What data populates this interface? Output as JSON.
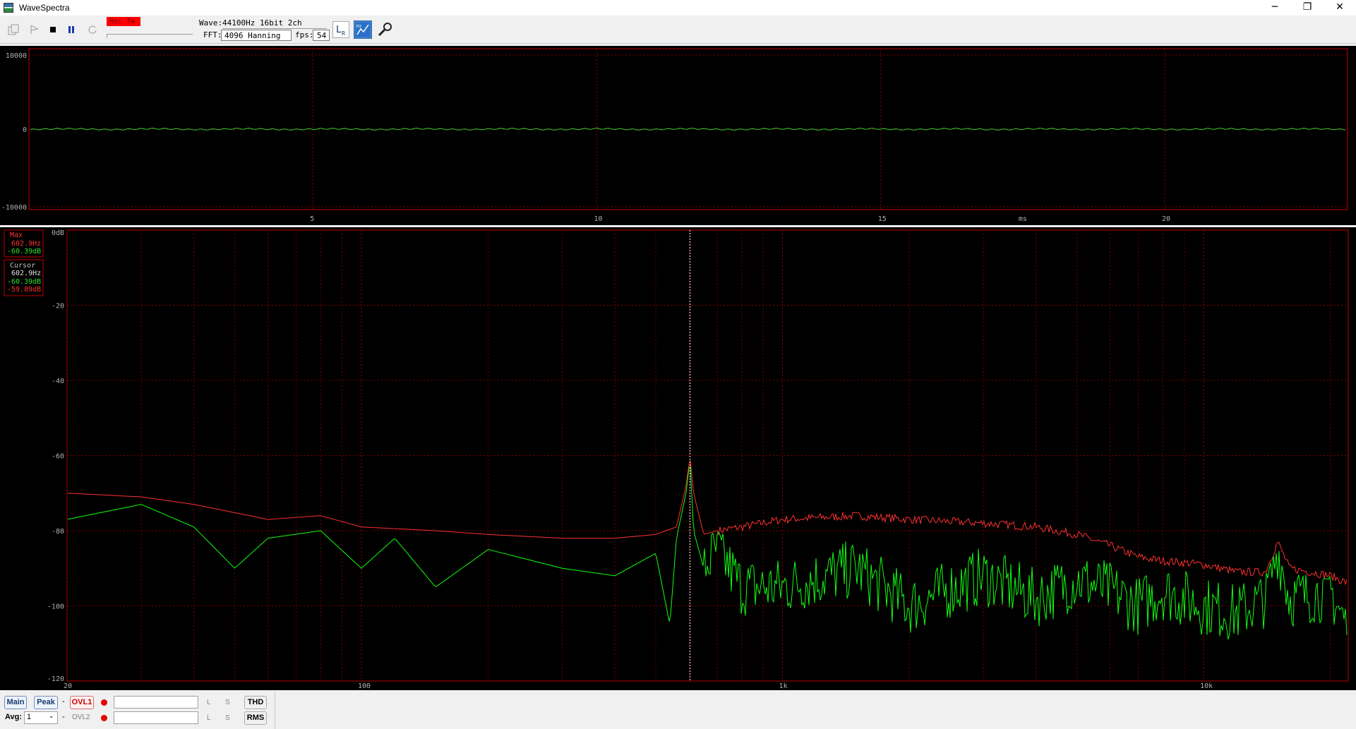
{
  "window": {
    "title": "WaveSpectra",
    "minimize": "─",
    "restore": "❐",
    "close": "✕"
  },
  "toolbar": {
    "rec_label": "Rec Tm",
    "wave_label": "Wave:",
    "wave_value": "44100Hz 16bit 2ch",
    "fft_label": "FFT:",
    "fft_value": "4096 Hanning",
    "fps_label": "fps:",
    "fps_value": "54",
    "icons": [
      "open-icon",
      "play-icon",
      "stop-icon",
      "pause-icon",
      "loop-icon",
      "lr-icon",
      "spectrum-settings-icon",
      "wrench-icon"
    ]
  },
  "waveform": {
    "y_ticks": [
      "10000",
      "0",
      "-10000"
    ],
    "x_ticks": [
      "5",
      "10",
      "15",
      "20"
    ],
    "x_unit": "ms"
  },
  "spectrum": {
    "y_ticks": [
      "0dB",
      "-20",
      "-40",
      "-60",
      "-80",
      "-100",
      "-120"
    ],
    "x_ticks": [
      "20",
      "100",
      "1k",
      "10k"
    ],
    "max_box": {
      "label": "Max",
      "freq": "602.9Hz",
      "db": "-60.39dB"
    },
    "cursor_box": {
      "label": "Cursor",
      "freq": "602.9Hz",
      "db1": "-60.39dB",
      "db2": "-59.89dB"
    },
    "colors": {
      "max_line": "#ff3030",
      "live_line": "#00ff00",
      "grid": "#c00000"
    }
  },
  "chart_data": {
    "type": "line",
    "xscale": "log",
    "xlim": [
      20,
      22050
    ],
    "ylim": [
      -120,
      0
    ],
    "xlabel": "",
    "ylabel": "",
    "series": [
      {
        "x": [
          20,
          30,
          40,
          60,
          80,
          100,
          150,
          200,
          300,
          400,
          500,
          560,
          590,
          602.9,
          615,
          650,
          700,
          800,
          1000,
          1500,
          2000,
          3000,
          4000,
          5000,
          6000,
          7000,
          8000,
          10000,
          12000,
          14000,
          15000,
          16000,
          18000,
          20000,
          22050
        ],
        "values": [
          -70,
          -71,
          -73,
          -77,
          -76,
          -79,
          -80,
          -81,
          -82,
          -82,
          -81,
          -79,
          -68,
          -60.39,
          -70,
          -81,
          -80,
          -79,
          -77,
          -76,
          -77,
          -78,
          -79,
          -81,
          -84,
          -87,
          -88,
          -89,
          -91,
          -91,
          -83,
          -90,
          -91,
          -92,
          -94
        ]
      },
      {
        "x": [
          20,
          30,
          40,
          50,
          60,
          80,
          100,
          120,
          150,
          200,
          300,
          400,
          500,
          540,
          560,
          590,
          602.9,
          615,
          650,
          700,
          800,
          1000,
          1500,
          2000,
          3000,
          4000,
          5000,
          6000,
          7000,
          8000,
          10000,
          12000,
          14000,
          15000,
          16000,
          18000,
          20000,
          22050
        ],
        "values": [
          -77,
          -73,
          -79,
          -90,
          -82,
          -80,
          -90,
          -82,
          -95,
          -85,
          -90,
          -92,
          -86,
          -105,
          -82,
          -70,
          -61,
          -80,
          -90,
          -85,
          -95,
          -95,
          -90,
          -100,
          -92,
          -98,
          -93,
          -96,
          -100,
          -96,
          -100,
          -102,
          -98,
          -85,
          -98,
          -97,
          -96,
          -106
        ]
      }
    ]
  },
  "bottom": {
    "main": "Main",
    "peak": "Peak",
    "dash1": "-",
    "ovl1": "OVL1",
    "ovl2": "OVL2",
    "l": "L",
    "s": "S",
    "thd": "THD",
    "rms": "RMS",
    "avg_label": "Avg:",
    "avg_value": "1",
    "dash2": "-"
  }
}
